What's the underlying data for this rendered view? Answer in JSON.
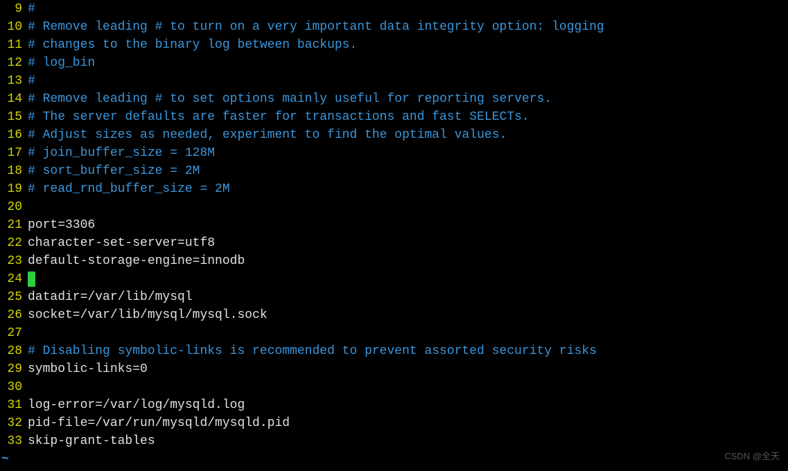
{
  "lines": [
    {
      "num": "9",
      "type": "comment",
      "text": "#"
    },
    {
      "num": "10",
      "type": "comment",
      "text": "# Remove leading # to turn on a very important data integrity option: logging"
    },
    {
      "num": "11",
      "type": "comment",
      "text": "# changes to the binary log between backups."
    },
    {
      "num": "12",
      "type": "comment",
      "text": "# log_bin"
    },
    {
      "num": "13",
      "type": "comment",
      "text": "#"
    },
    {
      "num": "14",
      "type": "comment",
      "text": "# Remove leading # to set options mainly useful for reporting servers."
    },
    {
      "num": "15",
      "type": "comment",
      "text": "# The server defaults are faster for transactions and fast SELECTs."
    },
    {
      "num": "16",
      "type": "comment",
      "text": "# Adjust sizes as needed, experiment to find the optimal values."
    },
    {
      "num": "17",
      "type": "comment",
      "text": "# join_buffer_size = 128M"
    },
    {
      "num": "18",
      "type": "comment",
      "text": "# sort_buffer_size = 2M"
    },
    {
      "num": "19",
      "type": "comment",
      "text": "# read_rnd_buffer_size = 2M"
    },
    {
      "num": "20",
      "type": "code",
      "text": ""
    },
    {
      "num": "21",
      "type": "code",
      "text": "port=3306"
    },
    {
      "num": "22",
      "type": "code",
      "text": "character-set-server=utf8"
    },
    {
      "num": "23",
      "type": "code",
      "text": "default-storage-engine=innodb"
    },
    {
      "num": "24",
      "type": "cursor",
      "text": ""
    },
    {
      "num": "25",
      "type": "code",
      "text": "datadir=/var/lib/mysql"
    },
    {
      "num": "26",
      "type": "code",
      "text": "socket=/var/lib/mysql/mysql.sock"
    },
    {
      "num": "27",
      "type": "code",
      "text": ""
    },
    {
      "num": "28",
      "type": "comment",
      "text": "# Disabling symbolic-links is recommended to prevent assorted security risks"
    },
    {
      "num": "29",
      "type": "code",
      "text": "symbolic-links=0"
    },
    {
      "num": "30",
      "type": "code",
      "text": ""
    },
    {
      "num": "31",
      "type": "code",
      "text": "log-error=/var/log/mysqld.log"
    },
    {
      "num": "32",
      "type": "code",
      "text": "pid-file=/var/run/mysqld/mysqld.pid"
    },
    {
      "num": "33",
      "type": "code",
      "text": "skip-grant-tables"
    }
  ],
  "tilde": "~",
  "watermark": "CSDN @全天"
}
